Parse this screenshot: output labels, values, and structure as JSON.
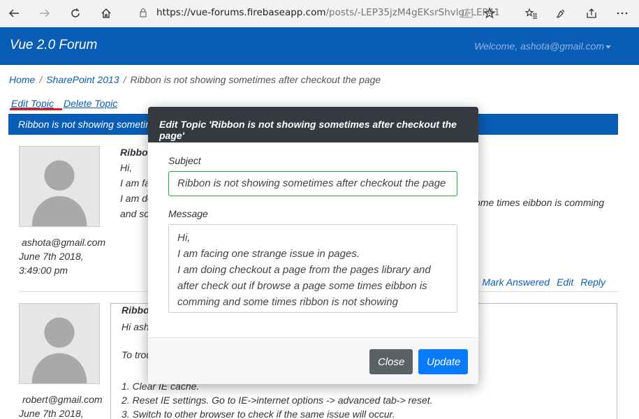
{
  "browser": {
    "url_host": "https://vue-forums.firebaseapp.com",
    "url_path": "/posts/-LEP35jzM4gEKsrShvlg/-LEP41",
    "icons": [
      "back-icon",
      "forward-icon",
      "refresh-icon",
      "home-icon",
      "lock-icon",
      "reading-view-icon",
      "favorite-star-icon",
      "favorites-list-icon",
      "pen-icon",
      "share-icon",
      "more-icon"
    ]
  },
  "navbar": {
    "brand": "Vue 2.0 Forum",
    "welcome": "Welcome, ashota@gmail.com"
  },
  "breadcrumb": {
    "home": "Home",
    "category": "SharePoint 2013",
    "sep": "/",
    "current": "Ribbon is not showing sometimes after checkout the page"
  },
  "topic_actions": {
    "edit": "Edit Topic",
    "delete": "Delete Topic"
  },
  "topic_bar": {
    "title": "Ribbon is not showing sometime"
  },
  "posts": [
    {
      "author": "ashota@gmail.com",
      "date": "June 7th 2018,",
      "time": "3:49:00 pm",
      "subject": "Ribbo",
      "lines": [
        "Hi,",
        "I am fa",
        "I am do",
        "and so"
      ],
      "tail": "ome times eibbon is comming",
      "links": [
        "Mark Answered",
        "Edit",
        "Reply"
      ]
    },
    {
      "author": "robert@gmail.com",
      "date": "June 7th 2018,",
      "subject": "Ribbo",
      "lines": [
        "Hi asho",
        "",
        "To trou",
        "",
        "1. Clear IE cache.",
        "2. Reset IE settings. Go to IE->internet options -> advanced tab-> reset.",
        "3. Switch to other browser to check if the same issue will occur."
      ]
    }
  ],
  "modal": {
    "title": "Edit Topic 'Ribbon is not showing sometimes after checkout the page'",
    "subject_label": "Subject",
    "subject_value": "Ribbon is not showing sometimes after checkout the page",
    "message_label": "Message",
    "message_value": "Hi,\nI am facing one strange issue in pages.\nI am doing checkout a page from the pages library and after check out if browse a page some times eibbon is comming and some times ribbon is not showing",
    "close_label": "Close",
    "update_label": "Update"
  },
  "colors": {
    "navbar": "#0a5db7",
    "modal_header": "#343a40",
    "close_button": "#5a6268",
    "update_button": "#0a7bff",
    "subject_border": "#28a745",
    "active_underline": "#e0201c"
  }
}
